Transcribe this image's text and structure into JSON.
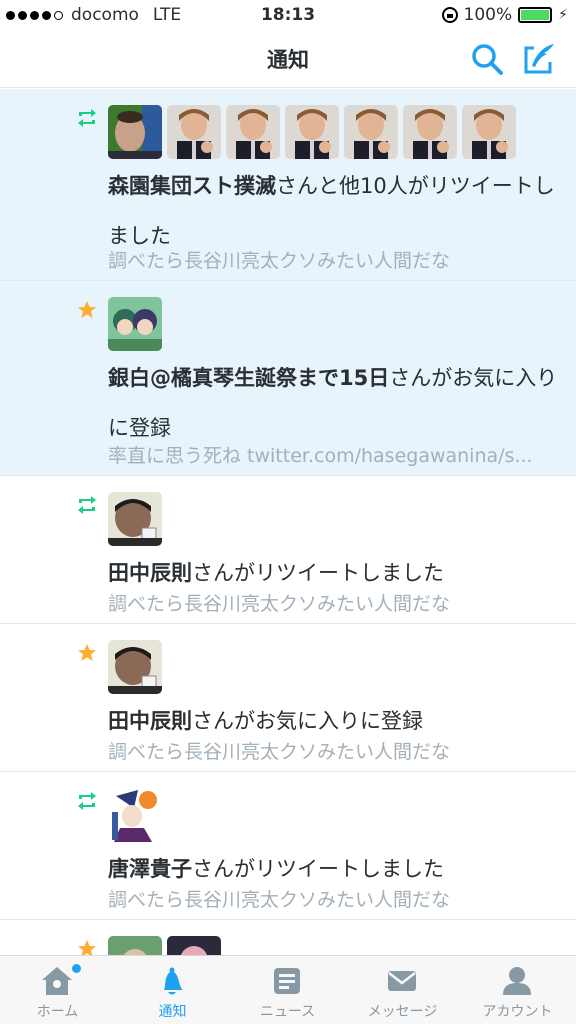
{
  "status_bar": {
    "carrier": "docomo",
    "network": "LTE",
    "time": "18:13",
    "battery": "100%",
    "signal_bars_filled": 4,
    "signal_bars_total": 5
  },
  "header": {
    "title": "通知",
    "search_icon": "search-icon",
    "compose_icon": "compose-tweet-icon"
  },
  "colors": {
    "accent": "#1da1f2",
    "retweet_green": "#19cf86",
    "favorite_gold": "#ffac33",
    "unread_bg": "#e8f4fc",
    "subtext": "#a3b0ba"
  },
  "notifications": [
    {
      "type": "retweet",
      "unread": true,
      "avatar_count": 7,
      "name": "森園集団スト撲滅",
      "action": "さんと他10人がリツイートしました",
      "tweet": "調べたら長谷川亮太クソみたい人間だな"
    },
    {
      "type": "favorite",
      "unread": true,
      "avatar_count": 1,
      "name": "銀白@橘真琴生誕祭まで15日",
      "action": "さんがお気に入りに登録",
      "tweet": "率直に思う死ね twitter.com/hasegawanina/s..."
    },
    {
      "type": "retweet",
      "unread": false,
      "avatar_count": 1,
      "name": "田中辰則",
      "action": "さんがリツイートしました",
      "tweet": "調べたら長谷川亮太クソみたい人間だな"
    },
    {
      "type": "favorite",
      "unread": false,
      "avatar_count": 1,
      "name": "田中辰則",
      "action": "さんがお気に入りに登録",
      "tweet": "調べたら長谷川亮太クソみたい人間だな"
    },
    {
      "type": "retweet",
      "unread": false,
      "avatar_count": 1,
      "name": "唐澤貴子",
      "action": "さんがリツイートしました",
      "tweet": "調べたら長谷川亮太クソみたい人間だな"
    },
    {
      "type": "favorite",
      "unread": false,
      "avatar_count": 2,
      "name": "",
      "action": "",
      "tweet": ""
    }
  ],
  "tabs": [
    {
      "label": "ホーム",
      "icon": "home-icon",
      "active": false
    },
    {
      "label": "通知",
      "icon": "bell-icon",
      "active": true
    },
    {
      "label": "ニュース",
      "icon": "news-icon",
      "active": false
    },
    {
      "label": "メッセージ",
      "icon": "envelope-icon",
      "active": false
    },
    {
      "label": "アカウント",
      "icon": "person-icon",
      "active": false
    }
  ]
}
